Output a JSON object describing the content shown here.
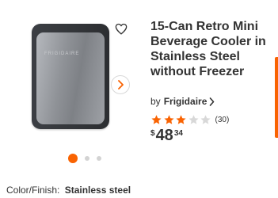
{
  "product": {
    "title": "15-Can Retro Mini Beverage Cooler in Stainless Steel without Freezer",
    "brand_prefix": "by",
    "brand": "Frigidaire",
    "rating": 3,
    "rating_max": 5,
    "review_count": "(30)",
    "price": {
      "symbol": "$",
      "dollars": "48",
      "cents": "34"
    },
    "image_logo_text": "FRIGIDAIRE"
  },
  "gallery": {
    "dot_count": 3,
    "active_index": 0
  },
  "color_finish": {
    "label": "Color/Finish:",
    "value": "Stainless steel"
  },
  "icons": {
    "favorite": "heart-icon",
    "next": "chevron-right-icon",
    "brand_link": "chevron-right-icon",
    "rating": "star-icon"
  },
  "colors": {
    "accent": "#f96302",
    "star_filled": "#f96302",
    "star_empty": "#d8d8d8",
    "text": "#333333"
  }
}
